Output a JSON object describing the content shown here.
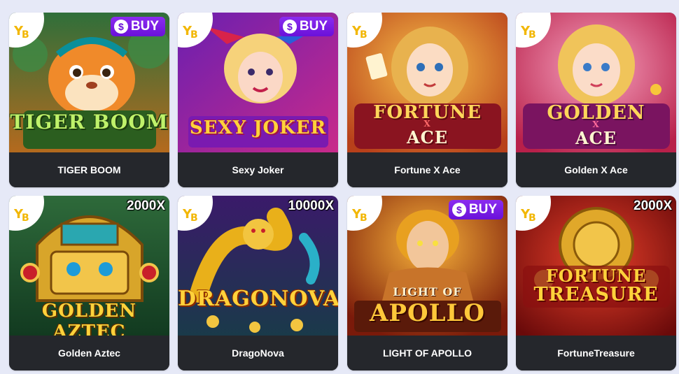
{
  "games": [
    {
      "name": "TIGER BOOM",
      "art_title": "TIGER BOOM",
      "badge": "BUY",
      "badge_icon": "dollar-icon"
    },
    {
      "name": "Sexy Joker",
      "art_title": "SEXY JOKER",
      "badge": "BUY",
      "badge_icon": "dollar-icon"
    },
    {
      "name": "Fortune X Ace",
      "art_title": "FORTUNE",
      "art_x": "X",
      "art_sub": "ACE"
    },
    {
      "name": "Golden X Ace",
      "art_title": "GOLDEN",
      "art_x": "X",
      "art_sub": "ACE"
    },
    {
      "name": "Golden Aztec",
      "art_title": "GOLDEN AZTEC",
      "badge": "2000X"
    },
    {
      "name": "DragoNova",
      "art_title": "DRAGONOVA",
      "badge": "10000X"
    },
    {
      "name": "LIGHT OF APOLLO",
      "art_title": "APOLLO",
      "art_top": "LIGHT OF",
      "badge": "BUY",
      "badge_icon": "dollar-icon"
    },
    {
      "name": "FortuneTreasure",
      "art_title": "TREASURE",
      "art_top": "FORTUNE",
      "badge": "2000X"
    }
  ],
  "provider_logo": "yes-bingo-logo",
  "colors": {
    "page_bg": "#e6e9f7",
    "card_footer": "#25272c",
    "buy_badge": "#7a1de6",
    "title_gold": "#f7c63a"
  }
}
